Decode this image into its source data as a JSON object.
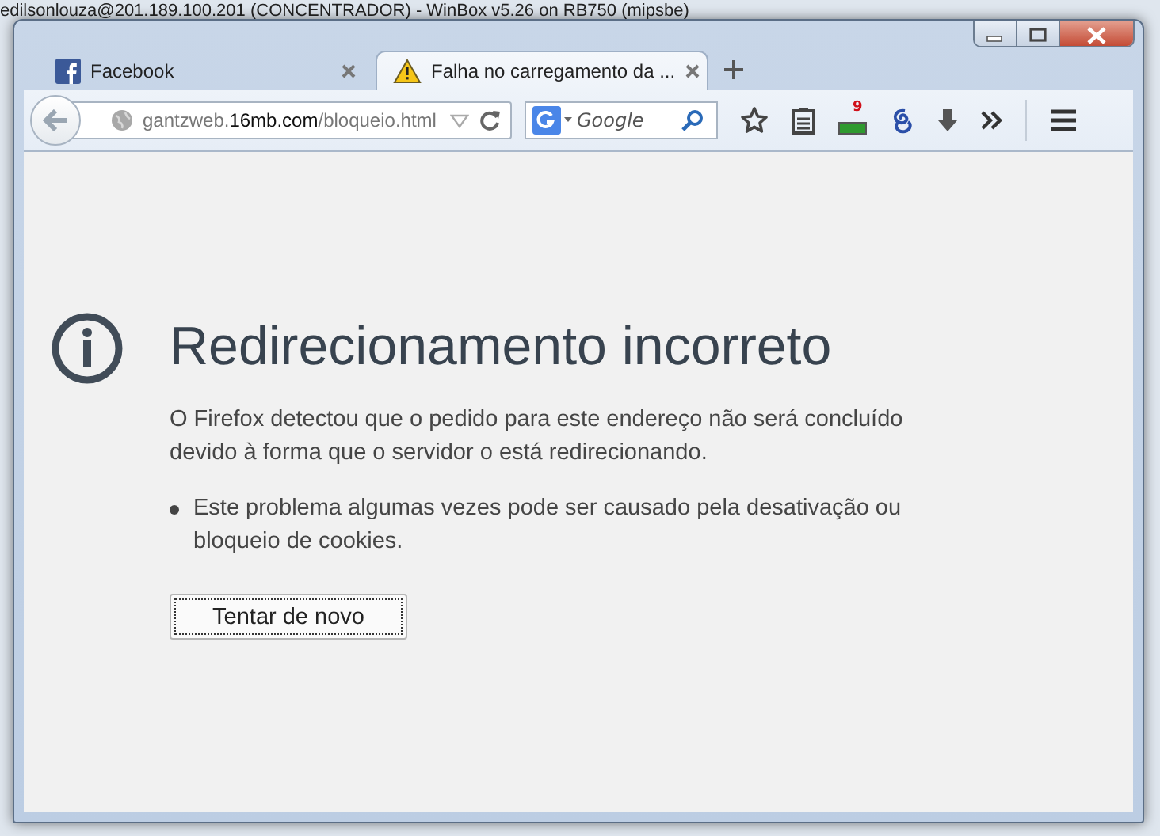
{
  "background_window": {
    "title": "edilsonlouza@201.189.100.201 (CONCENTRADOR) - WinBox v5.26 on RB750 (mipsbe)"
  },
  "tabs": [
    {
      "label": "Facebook",
      "selected": false
    },
    {
      "label": "Falha no carregamento da ...",
      "selected": true
    }
  ],
  "address_bar": {
    "host_prefix": "gantzweb.",
    "domain": "16mb.com",
    "path": "/bloqueio.html"
  },
  "search": {
    "placeholder": "Google"
  },
  "toolbar": {
    "addon_badge": "9"
  },
  "error": {
    "title": "Redirecionamento incorreto",
    "description": "O Firefox detectou que o pedido para este endereço não será concluído devido à forma que o servidor o está redirecionando.",
    "bullets": [
      "Este problema algumas vezes pode ser causado pela desativação ou bloqueio de cookies."
    ],
    "button": "Tentar de novo"
  }
}
